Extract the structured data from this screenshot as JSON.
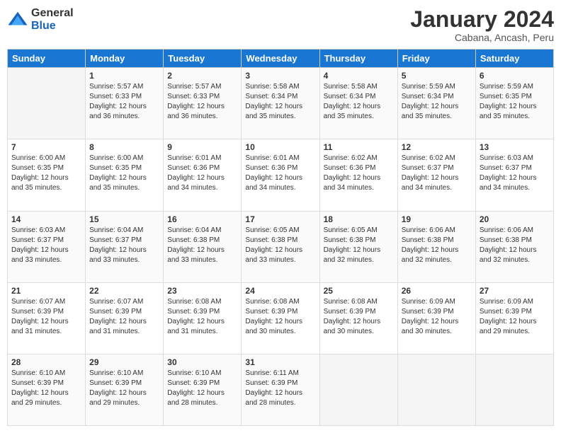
{
  "logo": {
    "general": "General",
    "blue": "Blue"
  },
  "title": "January 2024",
  "subtitle": "Cabana, Ancash, Peru",
  "days_of_week": [
    "Sunday",
    "Monday",
    "Tuesday",
    "Wednesday",
    "Thursday",
    "Friday",
    "Saturday"
  ],
  "weeks": [
    [
      {
        "day": "",
        "info": ""
      },
      {
        "day": "1",
        "info": "Sunrise: 5:57 AM\nSunset: 6:33 PM\nDaylight: 12 hours\nand 36 minutes."
      },
      {
        "day": "2",
        "info": "Sunrise: 5:57 AM\nSunset: 6:33 PM\nDaylight: 12 hours\nand 36 minutes."
      },
      {
        "day": "3",
        "info": "Sunrise: 5:58 AM\nSunset: 6:34 PM\nDaylight: 12 hours\nand 35 minutes."
      },
      {
        "day": "4",
        "info": "Sunrise: 5:58 AM\nSunset: 6:34 PM\nDaylight: 12 hours\nand 35 minutes."
      },
      {
        "day": "5",
        "info": "Sunrise: 5:59 AM\nSunset: 6:34 PM\nDaylight: 12 hours\nand 35 minutes."
      },
      {
        "day": "6",
        "info": "Sunrise: 5:59 AM\nSunset: 6:35 PM\nDaylight: 12 hours\nand 35 minutes."
      }
    ],
    [
      {
        "day": "7",
        "info": "Sunrise: 6:00 AM\nSunset: 6:35 PM\nDaylight: 12 hours\nand 35 minutes."
      },
      {
        "day": "8",
        "info": "Sunrise: 6:00 AM\nSunset: 6:35 PM\nDaylight: 12 hours\nand 35 minutes."
      },
      {
        "day": "9",
        "info": "Sunrise: 6:01 AM\nSunset: 6:36 PM\nDaylight: 12 hours\nand 34 minutes."
      },
      {
        "day": "10",
        "info": "Sunrise: 6:01 AM\nSunset: 6:36 PM\nDaylight: 12 hours\nand 34 minutes."
      },
      {
        "day": "11",
        "info": "Sunrise: 6:02 AM\nSunset: 6:36 PM\nDaylight: 12 hours\nand 34 minutes."
      },
      {
        "day": "12",
        "info": "Sunrise: 6:02 AM\nSunset: 6:37 PM\nDaylight: 12 hours\nand 34 minutes."
      },
      {
        "day": "13",
        "info": "Sunrise: 6:03 AM\nSunset: 6:37 PM\nDaylight: 12 hours\nand 34 minutes."
      }
    ],
    [
      {
        "day": "14",
        "info": "Sunrise: 6:03 AM\nSunset: 6:37 PM\nDaylight: 12 hours\nand 33 minutes."
      },
      {
        "day": "15",
        "info": "Sunrise: 6:04 AM\nSunset: 6:37 PM\nDaylight: 12 hours\nand 33 minutes."
      },
      {
        "day": "16",
        "info": "Sunrise: 6:04 AM\nSunset: 6:38 PM\nDaylight: 12 hours\nand 33 minutes."
      },
      {
        "day": "17",
        "info": "Sunrise: 6:05 AM\nSunset: 6:38 PM\nDaylight: 12 hours\nand 33 minutes."
      },
      {
        "day": "18",
        "info": "Sunrise: 6:05 AM\nSunset: 6:38 PM\nDaylight: 12 hours\nand 32 minutes."
      },
      {
        "day": "19",
        "info": "Sunrise: 6:06 AM\nSunset: 6:38 PM\nDaylight: 12 hours\nand 32 minutes."
      },
      {
        "day": "20",
        "info": "Sunrise: 6:06 AM\nSunset: 6:38 PM\nDaylight: 12 hours\nand 32 minutes."
      }
    ],
    [
      {
        "day": "21",
        "info": "Sunrise: 6:07 AM\nSunset: 6:39 PM\nDaylight: 12 hours\nand 31 minutes."
      },
      {
        "day": "22",
        "info": "Sunrise: 6:07 AM\nSunset: 6:39 PM\nDaylight: 12 hours\nand 31 minutes."
      },
      {
        "day": "23",
        "info": "Sunrise: 6:08 AM\nSunset: 6:39 PM\nDaylight: 12 hours\nand 31 minutes."
      },
      {
        "day": "24",
        "info": "Sunrise: 6:08 AM\nSunset: 6:39 PM\nDaylight: 12 hours\nand 30 minutes."
      },
      {
        "day": "25",
        "info": "Sunrise: 6:08 AM\nSunset: 6:39 PM\nDaylight: 12 hours\nand 30 minutes."
      },
      {
        "day": "26",
        "info": "Sunrise: 6:09 AM\nSunset: 6:39 PM\nDaylight: 12 hours\nand 30 minutes."
      },
      {
        "day": "27",
        "info": "Sunrise: 6:09 AM\nSunset: 6:39 PM\nDaylight: 12 hours\nand 29 minutes."
      }
    ],
    [
      {
        "day": "28",
        "info": "Sunrise: 6:10 AM\nSunset: 6:39 PM\nDaylight: 12 hours\nand 29 minutes."
      },
      {
        "day": "29",
        "info": "Sunrise: 6:10 AM\nSunset: 6:39 PM\nDaylight: 12 hours\nand 29 minutes."
      },
      {
        "day": "30",
        "info": "Sunrise: 6:10 AM\nSunset: 6:39 PM\nDaylight: 12 hours\nand 28 minutes."
      },
      {
        "day": "31",
        "info": "Sunrise: 6:11 AM\nSunset: 6:39 PM\nDaylight: 12 hours\nand 28 minutes."
      },
      {
        "day": "",
        "info": ""
      },
      {
        "day": "",
        "info": ""
      },
      {
        "day": "",
        "info": ""
      }
    ]
  ]
}
